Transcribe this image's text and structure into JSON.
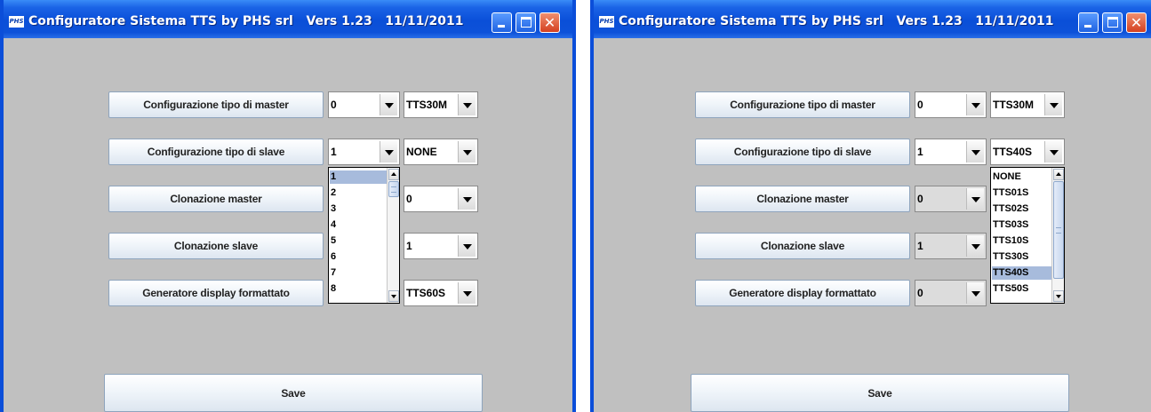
{
  "windows": [
    {
      "title": "Configuratore Sistema TTS by PHS srl   Vers 1.23   11/11/2011",
      "logo": "PHS",
      "close_glyph": "✕",
      "buttons": [
        "Configurazione tipo di master",
        "Configurazione tipo di slave",
        "Clonazione master",
        "Clonazione slave",
        "Generatore display formattato"
      ],
      "combos_a": [
        "0",
        "1",
        "",
        "",
        ""
      ],
      "combos_b": [
        "TTS30M",
        "NONE",
        "0",
        "1",
        "TTS60S"
      ],
      "popup": {
        "items": [
          "1",
          "2",
          "3",
          "4",
          "5",
          "6",
          "7",
          "8"
        ],
        "selected": "1"
      },
      "save_label": "Save"
    },
    {
      "title": "Configuratore Sistema TTS by PHS srl   Vers 1.23   11/11/2011",
      "logo": "PHS",
      "buttons": [
        "Configurazione tipo di master",
        "Configurazione tipo di slave",
        "Clonazione master",
        "Clonazione slave",
        "Generatore display formattato"
      ],
      "combos_a": [
        "0",
        "1",
        "0",
        "1",
        "0"
      ],
      "combos_b": [
        "TTS30M",
        "TTS40S",
        "",
        "",
        ""
      ],
      "popup": {
        "items": [
          "NONE",
          "TTS01S",
          "TTS02S",
          "TTS03S",
          "TTS10S",
          "TTS30S",
          "TTS40S",
          "TTS50S"
        ],
        "selected": "TTS40S"
      },
      "save_label": "Save"
    }
  ],
  "colors": {
    "titlebar": "#0a4fd8",
    "background": "#c0c0c0",
    "selection": "#a7bbdc",
    "close_button": "#d44020"
  },
  "icons": [
    "app-logo-icon",
    "minimize-icon",
    "maximize-icon",
    "close-icon",
    "dropdown-arrow-icon",
    "scroll-up-icon",
    "scroll-down-icon"
  ]
}
